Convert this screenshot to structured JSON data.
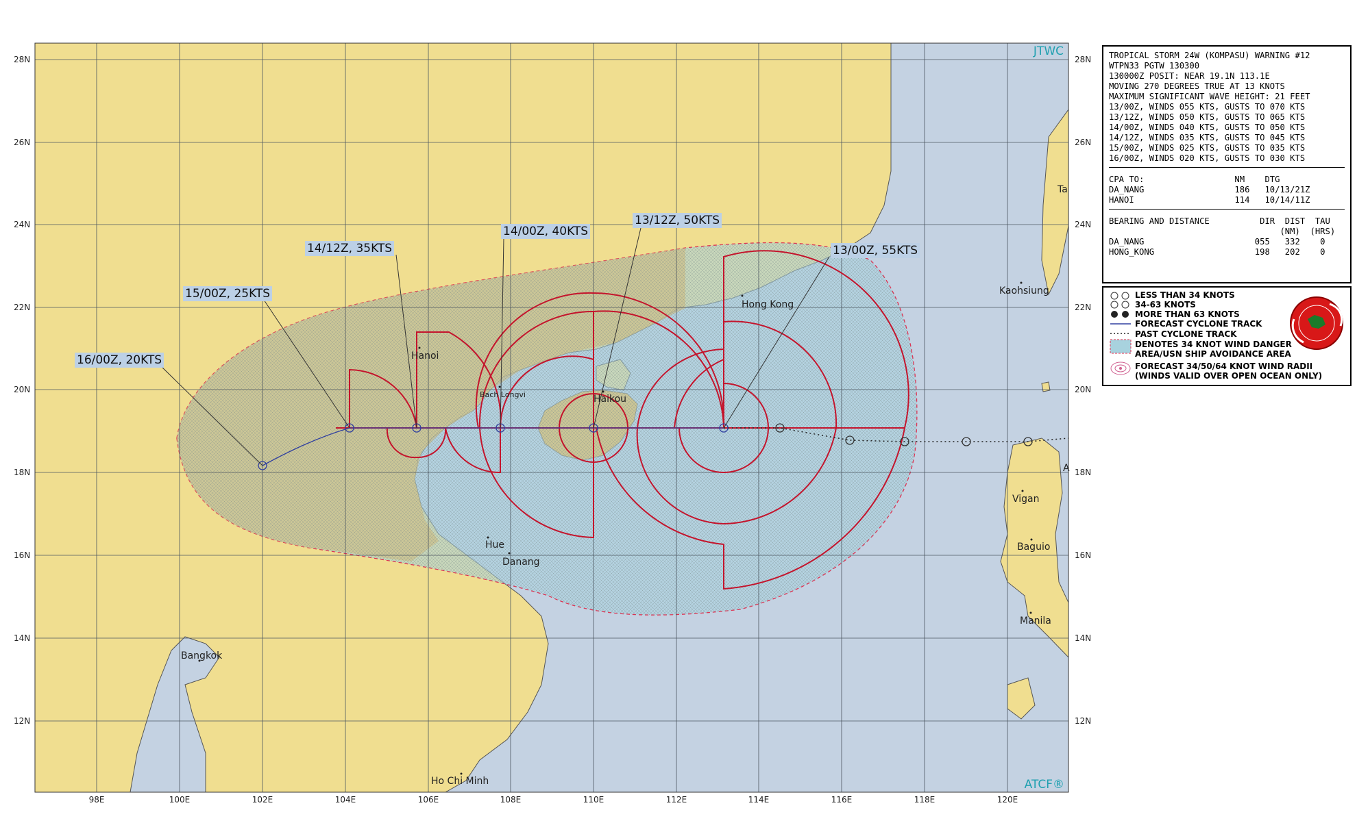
{
  "map": {
    "lat_labels": [
      "28N",
      "26N",
      "24N",
      "22N",
      "20N",
      "18N",
      "16N",
      "14N",
      "12N"
    ],
    "lon_labels": [
      "98E",
      "100E",
      "102E",
      "104E",
      "106E",
      "108E",
      "110E",
      "112E",
      "114E",
      "116E",
      "118E",
      "120E"
    ],
    "brand_top": "JTWC",
    "brand_bottom": "ATCF®",
    "cities": [
      {
        "name": "Hong Kong",
        "id": "hong-kong"
      },
      {
        "name": "Kaohsiung",
        "id": "kaohsiung"
      },
      {
        "name": "Hanoi",
        "id": "hanoi"
      },
      {
        "name": "Bach Longvi",
        "id": "bach-longvi"
      },
      {
        "name": "Haikou",
        "id": "haikou"
      },
      {
        "name": "Hue",
        "id": "hue"
      },
      {
        "name": "Danang",
        "id": "danang"
      },
      {
        "name": "Vigan",
        "id": "vigan"
      },
      {
        "name": "Baguio",
        "id": "baguio"
      },
      {
        "name": "Manila",
        "id": "manila"
      },
      {
        "name": "Bangkok",
        "id": "bangkok"
      },
      {
        "name": "Ho Chi Minh",
        "id": "ho-chi-minh"
      },
      {
        "name": "Ta",
        "id": "ta"
      },
      {
        "name": "A",
        "id": "a-partial"
      }
    ],
    "forecast_labels": [
      {
        "text": "13/00Z,  55KTS",
        "id": "13-00z"
      },
      {
        "text": "13/12Z,  50KTS",
        "id": "13-12z"
      },
      {
        "text": "14/00Z,  40KTS",
        "id": "14-00z"
      },
      {
        "text": "14/12Z,  35KTS",
        "id": "14-12z"
      },
      {
        "text": "15/00Z,  25KTS",
        "id": "15-00z"
      },
      {
        "text": "16/00Z,  20KTS",
        "id": "16-00z"
      }
    ],
    "colors": {
      "land": "#f0de90",
      "water": "#c4d2e2",
      "danger_land": "#dcc88c",
      "danger_water": "#a8d2de",
      "radii": "#c4142c",
      "track": "#3040a0"
    }
  },
  "info": {
    "header_lines": [
      "TROPICAL STORM 24W (KOMPASU) WARNING #12",
      "WTPN33 PGTW 130300",
      "130000Z POSIT: NEAR 19.1N 113.1E",
      "MOVING 270 DEGREES TRUE AT 13 KNOTS",
      "MAXIMUM SIGNIFICANT WAVE HEIGHT: 21 FEET",
      "13/00Z, WINDS 055 KTS, GUSTS TO 070 KTS",
      "13/12Z, WINDS 050 KTS, GUSTS TO 065 KTS",
      "14/00Z, WINDS 040 KTS, GUSTS TO 050 KTS",
      "14/12Z, WINDS 035 KTS, GUSTS TO 045 KTS",
      "15/00Z, WINDS 025 KTS, GUSTS TO 035 KTS",
      "16/00Z, WINDS 020 KTS, GUSTS TO 030 KTS"
    ],
    "cpa_lines": [
      "CPA TO:                  NM    DTG",
      "DA_NANG                  186   10/13/21Z",
      "HANOI                    114   10/14/11Z"
    ],
    "bearing_lines": [
      "BEARING AND DISTANCE          DIR  DIST  TAU",
      "                                  (NM)  (HRS)",
      "DA_NANG                      055   332    0",
      "HONG_KONG                    198   202    0"
    ]
  },
  "legend": {
    "items": [
      "LESS THAN 34 KNOTS",
      "34-63 KNOTS",
      "MORE THAN 63 KNOTS",
      "FORECAST CYCLONE TRACK",
      "PAST CYCLONE TRACK",
      "DENOTES 34 KNOT WIND DANGER",
      "AREA/USN SHIP AVOIDANCE AREA",
      "FORECAST 34/50/64 KNOT WIND RADII",
      "(WINDS VALID OVER OPEN OCEAN ONLY)"
    ]
  }
}
